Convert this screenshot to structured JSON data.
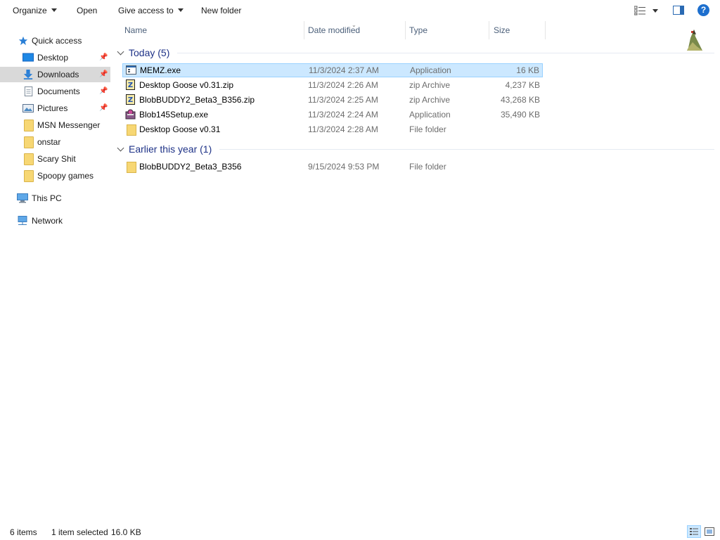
{
  "toolbar": {
    "organize": "Organize",
    "open": "Open",
    "give_access": "Give access to",
    "new_folder": "New folder",
    "help": "?"
  },
  "nav": {
    "quick_access": "Quick access",
    "items": [
      {
        "label": "Desktop",
        "pinned": true
      },
      {
        "label": "Downloads",
        "pinned": true,
        "selected": true
      },
      {
        "label": "Documents",
        "pinned": true
      },
      {
        "label": "Pictures",
        "pinned": true
      },
      {
        "label": "MSN Messenger"
      },
      {
        "label": "onstar"
      },
      {
        "label": "Scary Shit"
      },
      {
        "label": "Spoopy games"
      }
    ],
    "this_pc": "This PC",
    "network": "Network"
  },
  "columns": {
    "name": "Name",
    "date": "Date modified",
    "type": "Type",
    "size": "Size"
  },
  "groups": [
    {
      "title": "Today (5)",
      "files": [
        {
          "name": "MEMZ.exe",
          "date": "11/3/2024 2:37 AM",
          "type": "Application",
          "size": "16 KB",
          "icon": "exe-window-icon",
          "selected": true
        },
        {
          "name": "Desktop Goose v0.31.zip",
          "date": "11/3/2024 2:26 AM",
          "type": "zip Archive",
          "size": "4,237 KB",
          "icon": "zip-icon"
        },
        {
          "name": "BlobBUDDY2_Beta3_B356.zip",
          "date": "11/3/2024 2:25 AM",
          "type": "zip Archive",
          "size": "43,268 KB",
          "icon": "zip-icon"
        },
        {
          "name": "Blob145Setup.exe",
          "date": "11/3/2024 2:24 AM",
          "type": "Application",
          "size": "35,490 KB",
          "icon": "setup-icon"
        },
        {
          "name": "Desktop Goose v0.31",
          "date": "11/3/2024 2:28 AM",
          "type": "File folder",
          "size": "",
          "icon": "folder-icon"
        }
      ]
    },
    {
      "title": "Earlier this year (1)",
      "files": [
        {
          "name": "BlobBUDDY2_Beta3_B356",
          "date": "9/15/2024 9:53 PM",
          "type": "File folder",
          "size": "",
          "icon": "folder-icon"
        }
      ]
    }
  ],
  "status": {
    "items": "6 items",
    "selected": "1 item selected",
    "selected_size": "16.0 KB"
  },
  "colors": {
    "selection": "#cce8ff",
    "selection_border": "#99d1ff",
    "group_text": "#1e3287",
    "header_text": "#4c607a"
  }
}
